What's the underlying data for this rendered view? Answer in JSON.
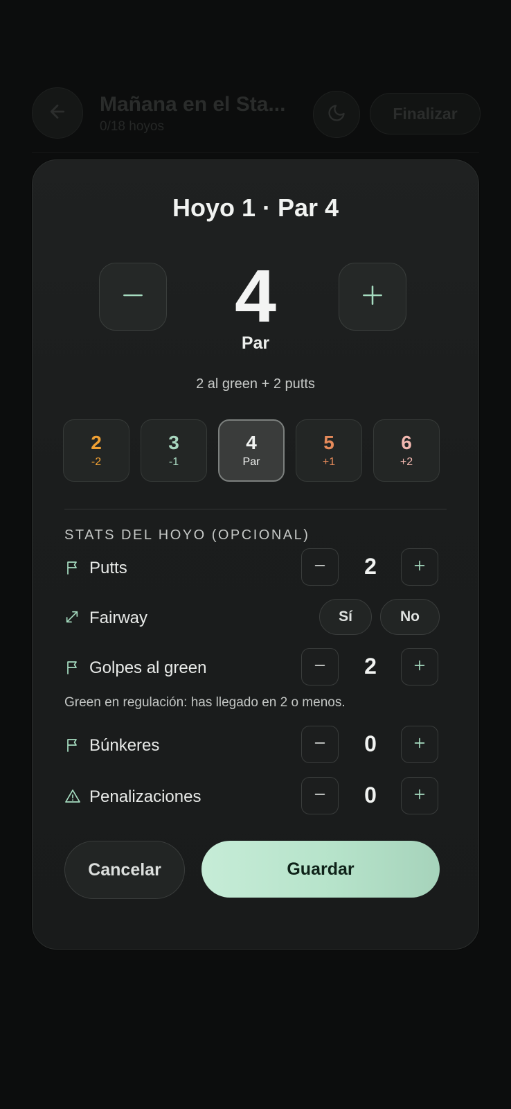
{
  "header": {
    "title": "Mañana en el Sta...",
    "subtitle": "0/18 hoyos",
    "finish_label": "Finalizar"
  },
  "modal": {
    "title": "Hoyo 1 · Par 4",
    "score": "4",
    "score_label": "Par",
    "breakdown": "2 al green + 2 putts",
    "quick_scores": [
      {
        "value": "2",
        "delta": "-2",
        "color": "#f0a033"
      },
      {
        "value": "3",
        "delta": "-1",
        "color": "#a9d8c0"
      },
      {
        "value": "4",
        "delta": "Par",
        "color": "#f1f3f1",
        "selected": true
      },
      {
        "value": "5",
        "delta": "+1",
        "color": "#e58a5a"
      },
      {
        "value": "6",
        "delta": "+2",
        "color": "#f2b8b0"
      }
    ],
    "section_title": "STATS DEL HOYO (OPCIONAL)",
    "stats": {
      "putts": {
        "label": "Putts",
        "value": "2"
      },
      "fairway": {
        "label": "Fairway",
        "yes": "Sí",
        "no": "No"
      },
      "gir": {
        "label": "Golpes al green",
        "value": "2"
      },
      "gir_note": "Green en regulación: has llegado en 2 o menos.",
      "bunkers": {
        "label": "Búnkeres",
        "value": "0"
      },
      "penalties": {
        "label": "Penalizaciones",
        "value": "0"
      }
    },
    "cancel_label": "Cancelar",
    "save_label": "Guardar"
  },
  "colors": {
    "accent": "#a6dcc0",
    "save_gradient_start": "#c6ecd7",
    "save_gradient_end": "#a6d3bb"
  }
}
